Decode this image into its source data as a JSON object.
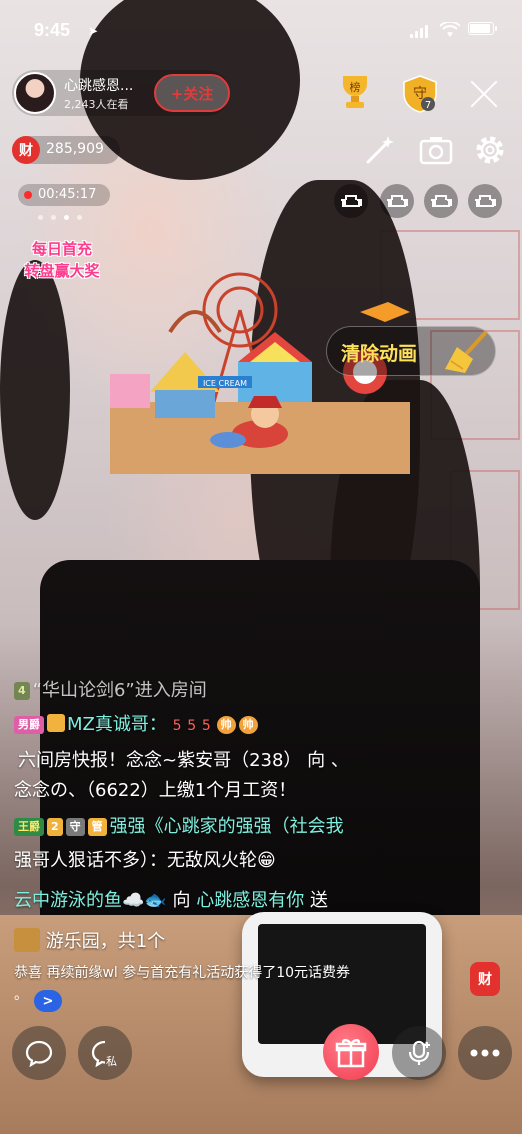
{
  "status_bar": {
    "time": "9:45"
  },
  "host": {
    "name": "心跳感恩...",
    "viewers": "2,243人在看",
    "follow_label": "+关注"
  },
  "top_icons": {
    "rank_label": "榜",
    "guard_label": "守",
    "guard_count": "7"
  },
  "wealth": {
    "badge": "财",
    "value": "285,909"
  },
  "live": {
    "duration": "00:45:17"
  },
  "promo": {
    "line1": "每日首充",
    "line2": "转盘赢大奖"
  },
  "gift_animation": {
    "sign_text": "ICE CREAM",
    "clear_label": "清除动画"
  },
  "chat": {
    "enter_level": "4",
    "enter_text": "“华山论剑6”进入房间",
    "msg1_badge": "男爵",
    "msg1_name": "MZ真诚哥：",
    "msg1_tags": [
      "5",
      "5",
      "5",
      "帅",
      "帅"
    ],
    "msg2_line1": "六间房快报！念念~紫安哥（238） 向 、",
    "msg2_line2": "念念の、（6622）上缴1个月工资！",
    "msg3_badge": "王爵",
    "msg3_level": "2",
    "msg3_guard": "守",
    "msg3_mgr": "管",
    "msg3_name": "强强《心跳家的强强（社会我",
    "msg3_line2": "强哥人狠话不多）：无敌风火轮😁",
    "msg4_sender": "云中游泳的鱼☁️🐟",
    "msg4_verb": " 向 ",
    "msg4_receiver": "心跳感恩有你",
    "msg4_action": " 送",
    "msg5_text": "游乐园，共1个",
    "system_text": "恭喜 再续前缘wl 参与首充有礼活动获得了10元话费券",
    "system_tail": "。",
    "expand_label": ">",
    "wealth_side": "财"
  },
  "bottom_bar": {
    "private_label": "私"
  },
  "colors": {
    "accent_red": "#e3322e",
    "gift_pink": "#f23d52",
    "chat_cyan": "#7ff0df",
    "clear_yellow": "#ffe05a"
  }
}
